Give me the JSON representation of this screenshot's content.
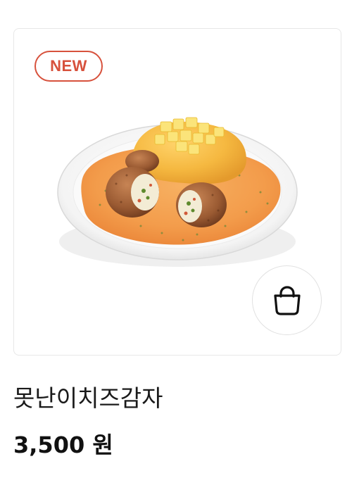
{
  "product": {
    "badge": "NEW",
    "image_alt": "potato cheese dish plate",
    "name": "못난이치즈감자",
    "price": "3,500 원",
    "cart_icon": "shopping-bag-icon"
  },
  "colors": {
    "badge": "#d7513c",
    "card_border": "#e7e7e7",
    "text": "#1a1a1a",
    "sauce": "#f4a24d",
    "plate": "#ffffff"
  }
}
